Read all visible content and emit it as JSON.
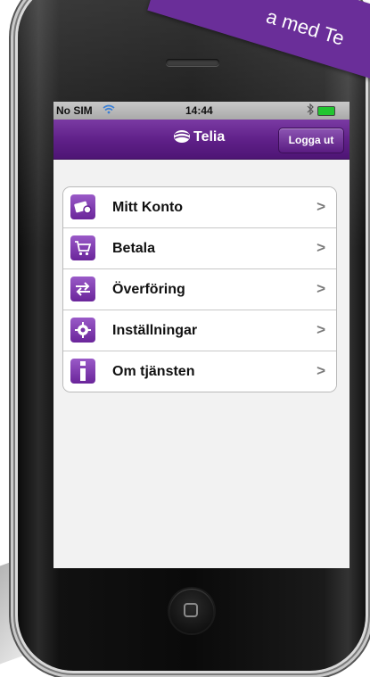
{
  "status_bar": {
    "carrier": "No SIM",
    "time": "14:44",
    "icons": [
      "wifi-icon",
      "bluetooth-icon",
      "battery-icon"
    ]
  },
  "header": {
    "brand": "Telia",
    "logout_label": "Logga ut",
    "color": "#5e1f87"
  },
  "menu": {
    "items": [
      {
        "label": "Mitt Konto",
        "icon": "card-icon"
      },
      {
        "label": "Betala",
        "icon": "cart-icon"
      },
      {
        "label": "Överföring",
        "icon": "transfer-arrows-icon"
      },
      {
        "label": "Inställningar",
        "icon": "gear-icon"
      },
      {
        "label": "Om tjänsten",
        "icon": "info-icon"
      }
    ],
    "chevron": ">"
  },
  "banner": {
    "text": "a med Te",
    "color": "#6a2e99"
  }
}
